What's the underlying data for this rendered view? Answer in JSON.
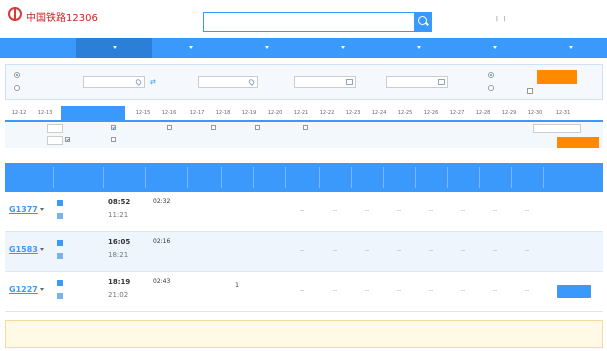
{
  "header": {
    "logo_text": "中国铁路12306",
    "logo_subtitle": "",
    "search_placeholder": "",
    "user": {
      "welcome": "",
      "username": "",
      "separator": "|",
      "logout": "",
      "lang": ""
    }
  },
  "nav": [
    {
      "label": "",
      "active": false
    },
    {
      "label": "",
      "active": true,
      "dropdown": true
    },
    {
      "label": "",
      "dropdown": true
    },
    {
      "label": "",
      "dropdown": true
    },
    {
      "label": "",
      "dropdown": true
    },
    {
      "label": "",
      "dropdown": true
    },
    {
      "label": "",
      "dropdown": true
    },
    {
      "label": "",
      "dropdown": true
    }
  ],
  "query": {
    "trip_type": {
      "oneway": "",
      "round": ""
    },
    "from_label": "",
    "from_value": "",
    "to_label": "",
    "to_value": "",
    "depart_label": "",
    "depart_value": "",
    "return_label": "",
    "return_value": "",
    "ticket_type": {
      "adult": "",
      "student": ""
    },
    "purpose_label": "",
    "search_button": ""
  },
  "dates": [
    {
      "label": "12-12"
    },
    {
      "label": "12-13"
    },
    {
      "label": "",
      "active": true
    },
    {
      "label": "12-15"
    },
    {
      "label": "12-16"
    },
    {
      "label": "12-17"
    },
    {
      "label": "12-18"
    },
    {
      "label": "12-19"
    },
    {
      "label": "12-20"
    },
    {
      "label": "12-21"
    },
    {
      "label": "12-22"
    },
    {
      "label": "12-23"
    },
    {
      "label": "12-24"
    },
    {
      "label": "12-25"
    },
    {
      "label": "12-26"
    },
    {
      "label": "12-27"
    },
    {
      "label": "12-28"
    },
    {
      "label": "12-29"
    },
    {
      "label": "12-30"
    },
    {
      "label": "12-31"
    }
  ],
  "filter": {
    "train_type_label": "",
    "all": "",
    "types": [
      {
        "label": "",
        "checked": true
      },
      {
        "label": "",
        "checked": false
      },
      {
        "label": "",
        "checked": false
      },
      {
        "label": "",
        "checked": false
      },
      {
        "label": "",
        "checked": false
      }
    ],
    "depart_time_label": "",
    "depart_time_value": "",
    "station_label": "",
    "station_all": "",
    "station_options": [
      {
        "label": "",
        "checked": true
      },
      {
        "label": "",
        "checked": false
      }
    ],
    "filter_button": ""
  },
  "info": {
    "route": "",
    "count_label": "",
    "hint_prefix": "",
    "hint_blue": "",
    "hint_orange": "",
    "hint_suffix": "",
    "show_fullprice": "",
    "show_transfer": ""
  },
  "table": {
    "headers": [
      "",
      "",
      "",
      "",
      "",
      "",
      "",
      "",
      "",
      "",
      "",
      "",
      "",
      "",
      "",
      "",
      ""
    ],
    "rows": [
      {
        "train": "G1377",
        "from": {
          "tag": "",
          "name": ""
        },
        "to": {
          "tag": "",
          "name": ""
        },
        "depart": "08:52",
        "arrive": "11:21",
        "duration": "02:32",
        "arrive_day": "",
        "seats": [
          {
            "avail": "",
            "price": ""
          },
          {
            "avail": "",
            "price": ""
          },
          {
            "avail": "",
            "price": ""
          }
        ],
        "other": [
          "--",
          "--",
          "--",
          "--",
          "--",
          "--",
          "--",
          "--",
          "--"
        ],
        "remark": "",
        "bookable": false
      },
      {
        "train": "G1583",
        "from": {
          "tag": "",
          "name": ""
        },
        "to": {
          "tag": "",
          "name": ""
        },
        "depart": "16:05",
        "arrive": "18:21",
        "duration": "02:16",
        "arrive_day": "",
        "seats": [
          {
            "avail": "",
            "price": ""
          },
          {
            "avail": "",
            "price": ""
          },
          {
            "avail": "",
            "price": ""
          }
        ],
        "other": [
          "--",
          "--",
          "--",
          "--",
          "--",
          "--",
          "--",
          "--",
          "--"
        ],
        "remark": "",
        "bookable": false
      },
      {
        "train": "G1227",
        "from": {
          "tag": "",
          "name": ""
        },
        "to": {
          "tag": "",
          "name": ""
        },
        "depart": "18:19",
        "arrive": "21:02",
        "duration": "02:43",
        "arrive_day": "",
        "seats": [
          {
            "avail": "",
            "price": ""
          },
          {
            "avail": "1",
            "price": ""
          },
          {
            "avail": "",
            "price": ""
          }
        ],
        "other": [
          "--",
          "--",
          "--",
          "--",
          "--",
          "--",
          "--",
          "--",
          "--"
        ],
        "remark": "",
        "bookable": true,
        "book_label": ""
      }
    ]
  },
  "notice": {
    "line1": "",
    "line1_hl": "",
    "line1_end": "",
    "line2": "",
    "line2_hl": "",
    "line2_end": ""
  },
  "colors": {
    "primary": "#3b99fc",
    "accent": "#ff8a00",
    "price": "#ff6a00",
    "logo": "#cc2222"
  }
}
